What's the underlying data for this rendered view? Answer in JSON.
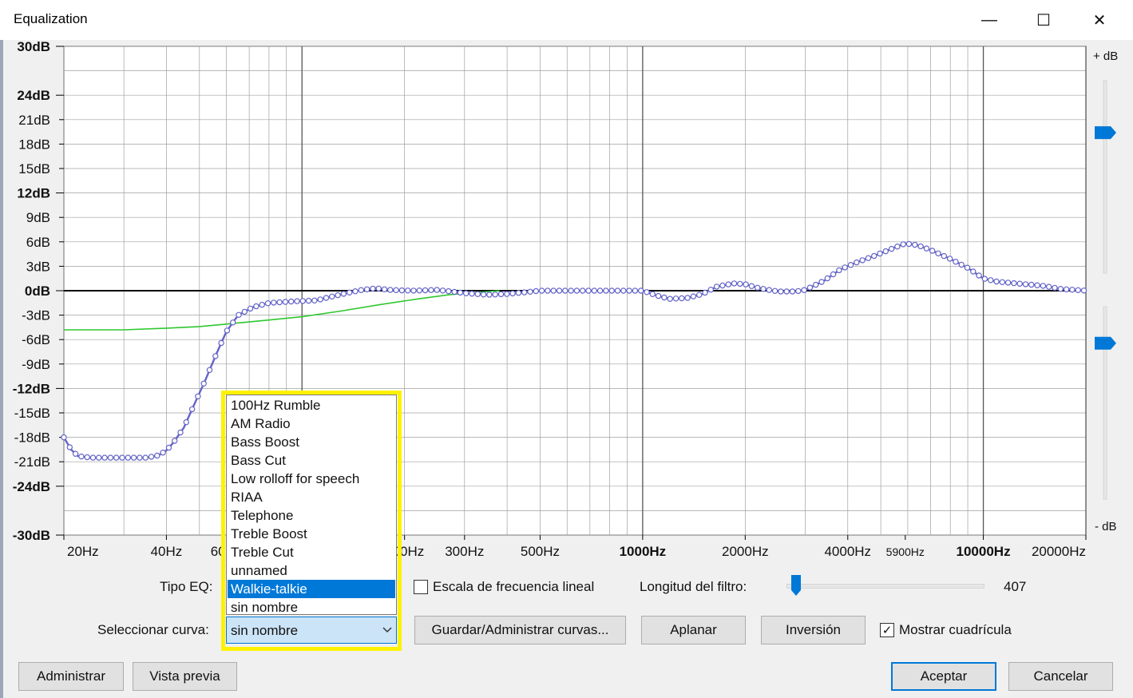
{
  "window": {
    "title": "Equalization",
    "controls": {
      "minimize": "—",
      "maximize": "☐",
      "close": "✕"
    }
  },
  "graph": {
    "db_labels": [
      "30dB",
      "24dB",
      "21dB",
      "18dB",
      "15dB",
      "12dB",
      "9dB",
      "6dB",
      "3dB",
      "0dB",
      "-3dB",
      "-6dB",
      "-9dB",
      "-12dB",
      "-15dB",
      "-18dB",
      "-21dB",
      "-24dB",
      "-30dB"
    ],
    "db_values": [
      30,
      24,
      21,
      18,
      15,
      12,
      9,
      6,
      3,
      0,
      -3,
      -6,
      -9,
      -12,
      -15,
      -18,
      -21,
      -24,
      -30
    ],
    "db_bold": [
      "30dB",
      "24dB",
      "12dB",
      "0dB",
      "-12dB",
      "-24dB",
      "-30dB"
    ],
    "freq_labels": [
      "20Hz",
      "40Hz",
      "60Hz",
      "200Hz",
      "300Hz",
      "500Hz",
      "1000Hz",
      "2000Hz",
      "4000Hz",
      "5900Hz",
      "10000Hz",
      "20000Hz"
    ],
    "freq_values": [
      20,
      40,
      60,
      200,
      300,
      500,
      1000,
      2000,
      4000,
      5900,
      10000,
      20000
    ],
    "freq_bold": [
      "1000Hz",
      "10000Hz"
    ],
    "db_axis_range": [
      -30,
      30
    ],
    "freq_axis_range": [
      20,
      20000
    ],
    "freq_scale": "log",
    "plus_db_label": "+ dB",
    "minus_db_label": "- dB",
    "gain_sliders": {
      "max_db_level": 0.27,
      "min_db_level": 0.19
    },
    "colors": {
      "background": "#ffffff",
      "grid": "#a0a0a0",
      "zero_line": "#000000",
      "eq_curve": "#6464c8",
      "points_fill": "#ffffff",
      "response_curve": "#2ec82e",
      "slider_thumb": "#0078d7"
    }
  },
  "chart_data": {
    "type": "line",
    "x_scale": "log",
    "xlim": [
      20,
      20000
    ],
    "ylim": [
      -30,
      30
    ],
    "grid": true,
    "series": [
      {
        "points": [
          [
            20,
            -18
          ],
          [
            21,
            -19.5
          ],
          [
            22,
            -20.3
          ],
          [
            24,
            -20.5
          ],
          [
            30,
            -20.5
          ],
          [
            35,
            -20.5
          ],
          [
            38,
            -20.2
          ],
          [
            40,
            -19.6
          ],
          [
            42,
            -18.6
          ],
          [
            45,
            -16.8
          ],
          [
            48,
            -14.2
          ],
          [
            52,
            -11
          ],
          [
            56,
            -7.8
          ],
          [
            60,
            -5
          ],
          [
            65,
            -3
          ],
          [
            72,
            -2
          ],
          [
            80,
            -1.5
          ],
          [
            95,
            -1.3
          ],
          [
            110,
            -1.2
          ],
          [
            120,
            -0.8
          ],
          [
            135,
            -0.3
          ],
          [
            150,
            0.1
          ],
          [
            165,
            0.3
          ],
          [
            180,
            0.1
          ],
          [
            210,
            0
          ],
          [
            250,
            0.1
          ],
          [
            300,
            -0.3
          ],
          [
            350,
            -0.5
          ],
          [
            400,
            -0.4
          ],
          [
            450,
            -0.2
          ],
          [
            500,
            0
          ],
          [
            700,
            0
          ],
          [
            900,
            0
          ],
          [
            1000,
            0
          ],
          [
            1100,
            -0.6
          ],
          [
            1200,
            -1
          ],
          [
            1350,
            -0.9
          ],
          [
            1500,
            -0.4
          ],
          [
            1650,
            0.5
          ],
          [
            1850,
            0.9
          ],
          [
            2000,
            0.8
          ],
          [
            2200,
            0.3
          ],
          [
            2500,
            -0.1
          ],
          [
            2800,
            -0.1
          ],
          [
            3000,
            0.1
          ],
          [
            3400,
            1.2
          ],
          [
            3800,
            2.6
          ],
          [
            4200,
            3.4
          ],
          [
            4800,
            4.3
          ],
          [
            5500,
            5.3
          ],
          [
            5900,
            5.8
          ],
          [
            6400,
            5.6
          ],
          [
            7000,
            5
          ],
          [
            8000,
            3.9
          ],
          [
            9000,
            2.8
          ],
          [
            10000,
            1.5
          ],
          [
            11000,
            1.1
          ],
          [
            12500,
            0.9
          ],
          [
            15000,
            0.6
          ],
          [
            17000,
            0.2
          ],
          [
            20000,
            0
          ]
        ]
      },
      {
        "points": [
          [
            20,
            -4.8
          ],
          [
            30,
            -4.8
          ],
          [
            40,
            -4.6
          ],
          [
            50,
            -4.4
          ],
          [
            60,
            -4.1
          ],
          [
            80,
            -3.6
          ],
          [
            100,
            -3.2
          ],
          [
            130,
            -2.5
          ],
          [
            170,
            -1.7
          ],
          [
            220,
            -1
          ],
          [
            270,
            -0.5
          ],
          [
            330,
            -0.2
          ],
          [
            380,
            0
          ]
        ]
      }
    ]
  },
  "controls": {
    "tipo_eq_label": "Tipo EQ:",
    "linear_scale_label": "Escala de frecuencia lineal",
    "linear_scale_checked": false,
    "filter_length_label": "Longitud del filtro:",
    "filter_length_value": "407",
    "filter_length_level": 0.05,
    "select_curve_label": "Seleccionar curva:",
    "selected_curve": "sin nombre",
    "save_manage_button": "Guardar/Administrar curvas...",
    "flatten_button": "Aplanar",
    "invert_button": "Inversión",
    "show_grid_label": "Mostrar cuadrícula",
    "show_grid_checked": true
  },
  "dropdown": {
    "items": [
      "100Hz Rumble",
      "AM Radio",
      "Bass Boost",
      "Bass Cut",
      "Low rolloff for speech",
      "RIAA",
      "Telephone",
      "Treble Boost",
      "Treble Cut",
      "unnamed",
      "Walkie-talkie",
      "sin nombre"
    ],
    "highlighted": "Walkie-talkie"
  },
  "footer": {
    "manage_button": "Administrar",
    "preview_button": "Vista previa",
    "ok_button": "Aceptar",
    "cancel_button": "Cancelar"
  }
}
